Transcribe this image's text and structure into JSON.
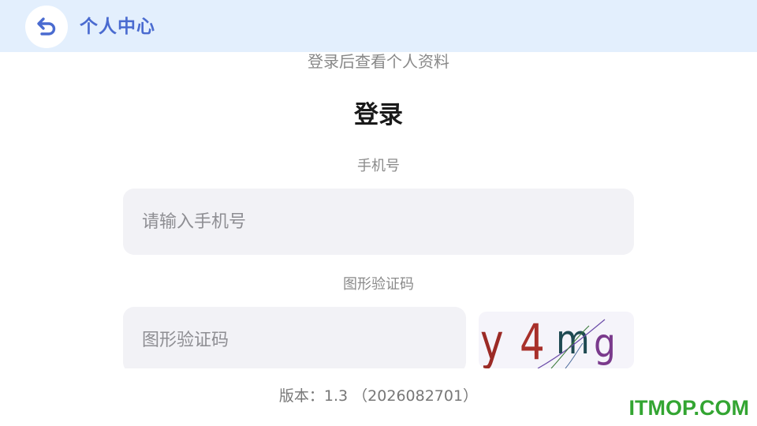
{
  "header": {
    "title": "个人中心",
    "back_icon": "undo-arrow-icon"
  },
  "login": {
    "subtitle": "登录后查看个人资料",
    "title": "登录",
    "phone_label": "手机号",
    "phone_placeholder": "请输入手机号",
    "phone_value": "",
    "captcha_label": "图形验证码",
    "captcha_placeholder": "图形验证码",
    "captcha_value": "",
    "captcha_text": "y4mg"
  },
  "footer": {
    "version": "版本：1.3 （2026082701）"
  },
  "watermark": {
    "text": "ITMOP.COM"
  },
  "colors": {
    "header_bg": "#e3effd",
    "accent": "#4a6bd0",
    "input_bg": "#f2f2f6",
    "watermark": "#33a532"
  }
}
